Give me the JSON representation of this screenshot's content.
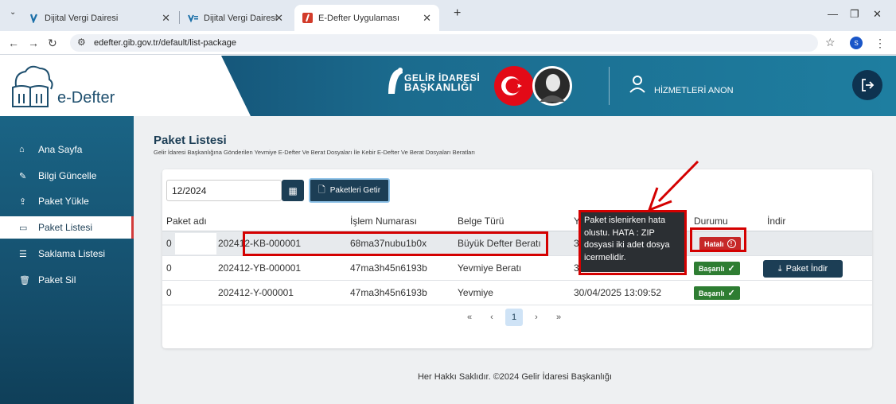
{
  "browser": {
    "tabs": [
      {
        "title": "Dijital Vergi Dairesi"
      },
      {
        "title": "Dijital Vergi Dairesi"
      },
      {
        "title": "E-Defter Uygulaması"
      }
    ],
    "url": "edefter.gib.gov.tr/default/list-package",
    "profile_initial": "S"
  },
  "header": {
    "logo_text": "e-Defter",
    "gib_line1": "GELİR İDARESİ",
    "gib_line2": "BAŞKANLIĞI",
    "user_text": "HİZMETLERİ ANON"
  },
  "sidebar": {
    "items": [
      {
        "label": "Ana Sayfa",
        "icon": "home-icon"
      },
      {
        "label": "Bilgi Güncelle",
        "icon": "user-edit-icon"
      },
      {
        "label": "Paket Yükle",
        "icon": "upload-icon"
      },
      {
        "label": "Paket Listesi",
        "icon": "inbox-icon"
      },
      {
        "label": "Saklama Listesi",
        "icon": "database-icon"
      },
      {
        "label": "Paket Sil",
        "icon": "trash-icon"
      }
    ]
  },
  "page": {
    "title": "Paket Listesi",
    "subtitle": "Gelir İdaresi Başkanlığına Gönderilen Yevmiye E-Defter Ve Berat Dosyaları İle Kebir E-Defter Ve Berat Dosyaları Beratları"
  },
  "filter": {
    "date_value": "12/2024",
    "get_button": "Paketleri Getir"
  },
  "table": {
    "headers": [
      "Paket adı",
      "İşlem Numarası",
      "Belge Türü",
      "Y",
      "Durumu",
      "İndir"
    ],
    "rows": [
      {
        "name_prefix": "0",
        "name": "202412-KB-000001",
        "islem": "68ma37nubu1b0x",
        "tur": "Büyük Defter Beratı",
        "date": "30",
        "status": "Hatalı",
        "download": ""
      },
      {
        "name_prefix": "0",
        "name": "202412-YB-000001",
        "islem": "47ma3h45n6193b",
        "tur": "Yevmiye Beratı",
        "date": "30",
        "status": "Başarılı",
        "download": "Paket İndir"
      },
      {
        "name_prefix": "0",
        "name": "202412-Y-000001",
        "islem": "47ma3h45n6193b",
        "tur": "Yevmiye",
        "date": "30/04/2025 13:09:52",
        "status": "Başarılı",
        "download": ""
      }
    ]
  },
  "pagination": {
    "first": "«",
    "prev": "‹",
    "current": "1",
    "next": "›",
    "last": "»"
  },
  "tooltip": {
    "lines": [
      "Paket islenirken hata",
      "olustu. HATA : ZIP",
      "dosyasi iki adet dosya",
      "icermelidir."
    ]
  },
  "footer": "Her Hakkı Saklıdır. ©2024 Gelir İdaresi Başkanlığı",
  "colors": {
    "primary": "#1c3e55",
    "error": "#c62828",
    "success": "#2e7d32",
    "annotation": "#d40000"
  }
}
